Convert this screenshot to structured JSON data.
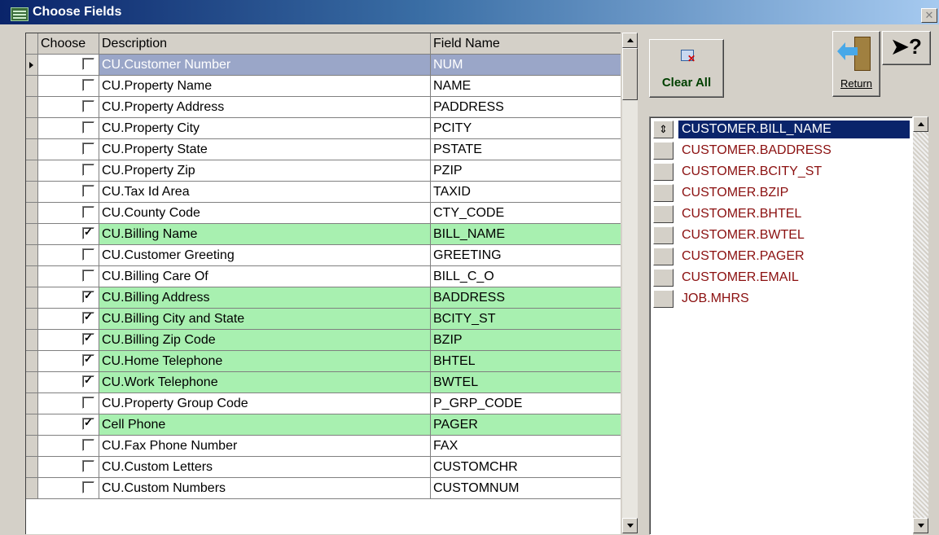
{
  "window": {
    "title": "Choose Fields"
  },
  "grid": {
    "headers": {
      "choose": "Choose",
      "description": "Description",
      "field_name": "Field Name"
    },
    "rows": [
      {
        "description": "CU.Customer Number",
        "field": "NUM",
        "checked": false,
        "current": true
      },
      {
        "description": "CU.Property Name",
        "field": "NAME",
        "checked": false
      },
      {
        "description": "CU.Property Address",
        "field": "PADDRESS",
        "checked": false
      },
      {
        "description": "CU.Property City",
        "field": "PCITY",
        "checked": false
      },
      {
        "description": "CU.Property State",
        "field": "PSTATE",
        "checked": false
      },
      {
        "description": "CU.Property Zip",
        "field": "PZIP",
        "checked": false
      },
      {
        "description": "CU.Tax Id Area",
        "field": "TAXID",
        "checked": false
      },
      {
        "description": "CU.County Code",
        "field": "CTY_CODE",
        "checked": false
      },
      {
        "description": "CU.Billing Name",
        "field": "BILL_NAME",
        "checked": true
      },
      {
        "description": "CU.Customer Greeting",
        "field": "GREETING",
        "checked": false
      },
      {
        "description": "CU.Billing Care Of",
        "field": "BILL_C_O",
        "checked": false
      },
      {
        "description": "CU.Billing Address",
        "field": "BADDRESS",
        "checked": true
      },
      {
        "description": "CU.Billing City and State",
        "field": "BCITY_ST",
        "checked": true
      },
      {
        "description": "CU.Billing Zip Code",
        "field": "BZIP",
        "checked": true
      },
      {
        "description": "CU.Home Telephone",
        "field": "BHTEL",
        "checked": true
      },
      {
        "description": "CU.Work Telephone",
        "field": "BWTEL",
        "checked": true
      },
      {
        "description": "CU.Property Group Code",
        "field": "P_GRP_CODE",
        "checked": false
      },
      {
        "description": "Cell Phone",
        "field": "PAGER",
        "checked": true
      },
      {
        "description": "CU.Fax Phone Number",
        "field": "FAX",
        "checked": false
      },
      {
        "description": "CU.Custom Letters",
        "field": "CUSTOMCHR",
        "checked": false
      },
      {
        "description": "CU.Custom Numbers",
        "field": "CUSTOMNUM",
        "checked": false
      }
    ]
  },
  "toolbar": {
    "clear_all_label": "Clear All",
    "return_label": "Return",
    "help_label": "?"
  },
  "selected_list": {
    "items": [
      {
        "label": "CUSTOMER.BILL_NAME",
        "selected": true
      },
      {
        "label": "CUSTOMER.BADDRESS"
      },
      {
        "label": "CUSTOMER.BCITY_ST"
      },
      {
        "label": "CUSTOMER.BZIP"
      },
      {
        "label": "CUSTOMER.BHTEL"
      },
      {
        "label": "CUSTOMER.BWTEL"
      },
      {
        "label": "CUSTOMER.PAGER"
      },
      {
        "label": "CUSTOMER.EMAIL"
      },
      {
        "label": "JOB.MHRS"
      }
    ],
    "move_glyph": "⇕"
  }
}
